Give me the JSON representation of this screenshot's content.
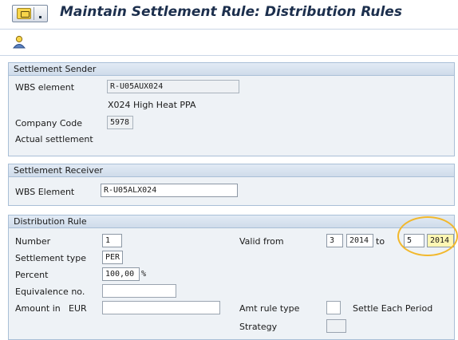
{
  "window": {
    "title": "Maintain Settlement Rule: Distribution Rules",
    "menu_icon": "sap-menu-icon"
  },
  "toolbar": {
    "icons": [
      "person-responsible-icon"
    ]
  },
  "sender": {
    "title": "Settlement Sender",
    "wbs_label": "WBS element",
    "wbs_value": "R-U05AUX024",
    "wbs_description": "X024 High Heat PPA",
    "company_label": "Company Code",
    "company_value": "5978",
    "actual_label": "Actual settlement"
  },
  "receiver": {
    "title": "Settlement Receiver",
    "wbs_label": "WBS Element",
    "wbs_value": "R-U05ALX024"
  },
  "rule": {
    "title": "Distribution Rule",
    "number_label": "Number",
    "number_value": "1",
    "settlement_type_label": "Settlement type",
    "settlement_type_value": "PER",
    "percent_label": "Percent",
    "percent_value": "100,00",
    "percent_unit": "%",
    "equivalence_label": "Equivalence no.",
    "equivalence_value": "",
    "amount_label": "Amount in",
    "amount_currency": "EUR",
    "amount_value": "",
    "valid_from_label": "Valid from",
    "valid_from_period": "3",
    "valid_from_year": "2014",
    "to_label": "to",
    "valid_to_period": "5",
    "valid_to_year": "2014",
    "amt_rule_type_label": "Amt rule type",
    "amt_rule_type_value": "",
    "amt_rule_type_text": "Settle Each Period",
    "strategy_label": "Strategy",
    "strategy_value": ""
  },
  "colors": {
    "title_text": "#1c2f4d",
    "group_background": "#eef2f6",
    "group_header": "#cfdcea",
    "highlight_field": "#fff7b4",
    "annotation_ellipse": "#f2b82c"
  }
}
